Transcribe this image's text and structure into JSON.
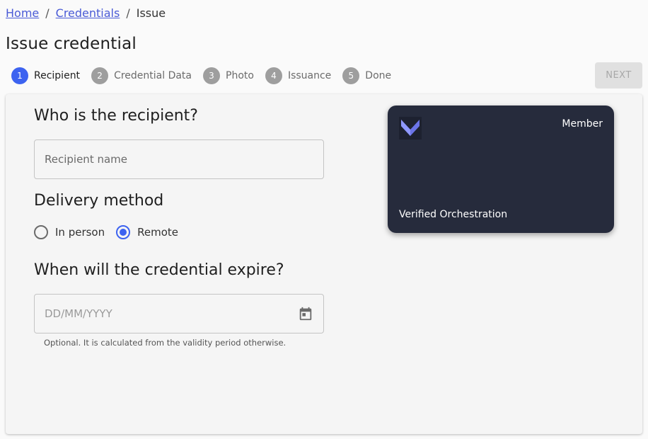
{
  "breadcrumb": {
    "items": [
      {
        "label": "Home",
        "link": true
      },
      {
        "label": "Credentials",
        "link": true
      },
      {
        "label": "Issue",
        "link": false
      }
    ],
    "separator": "/"
  },
  "page": {
    "title": "Issue credential"
  },
  "stepper": {
    "steps": [
      {
        "number": "1",
        "label": "Recipient",
        "active": true
      },
      {
        "number": "2",
        "label": "Credential Data",
        "active": false
      },
      {
        "number": "3",
        "label": "Photo",
        "active": false
      },
      {
        "number": "4",
        "label": "Issuance",
        "active": false
      },
      {
        "number": "5",
        "label": "Done",
        "active": false
      }
    ],
    "next_label": "NEXT",
    "next_disabled": true
  },
  "form": {
    "recipient_heading": "Who is the recipient?",
    "recipient_placeholder": "Recipient name",
    "recipient_value": "",
    "delivery_heading": "Delivery method",
    "delivery_options": [
      {
        "label": "In person",
        "checked": false
      },
      {
        "label": "Remote",
        "checked": true
      }
    ],
    "expiry_heading": "When will the credential expire?",
    "expiry_placeholder": "DD/MM/YYYY",
    "expiry_value": "",
    "expiry_helper": "Optional. It is calculated from the validity period otherwise."
  },
  "card_preview": {
    "type_label": "Member",
    "org_name": "Verified Orchestration",
    "background_color": "#262b3c",
    "logo_icon": "chevron-v-logo"
  },
  "colors": {
    "accent": "#3d63f0",
    "link": "#4a5bd6",
    "step_inactive": "#9e9e9e",
    "disabled_button_bg": "#e0e0e0"
  }
}
